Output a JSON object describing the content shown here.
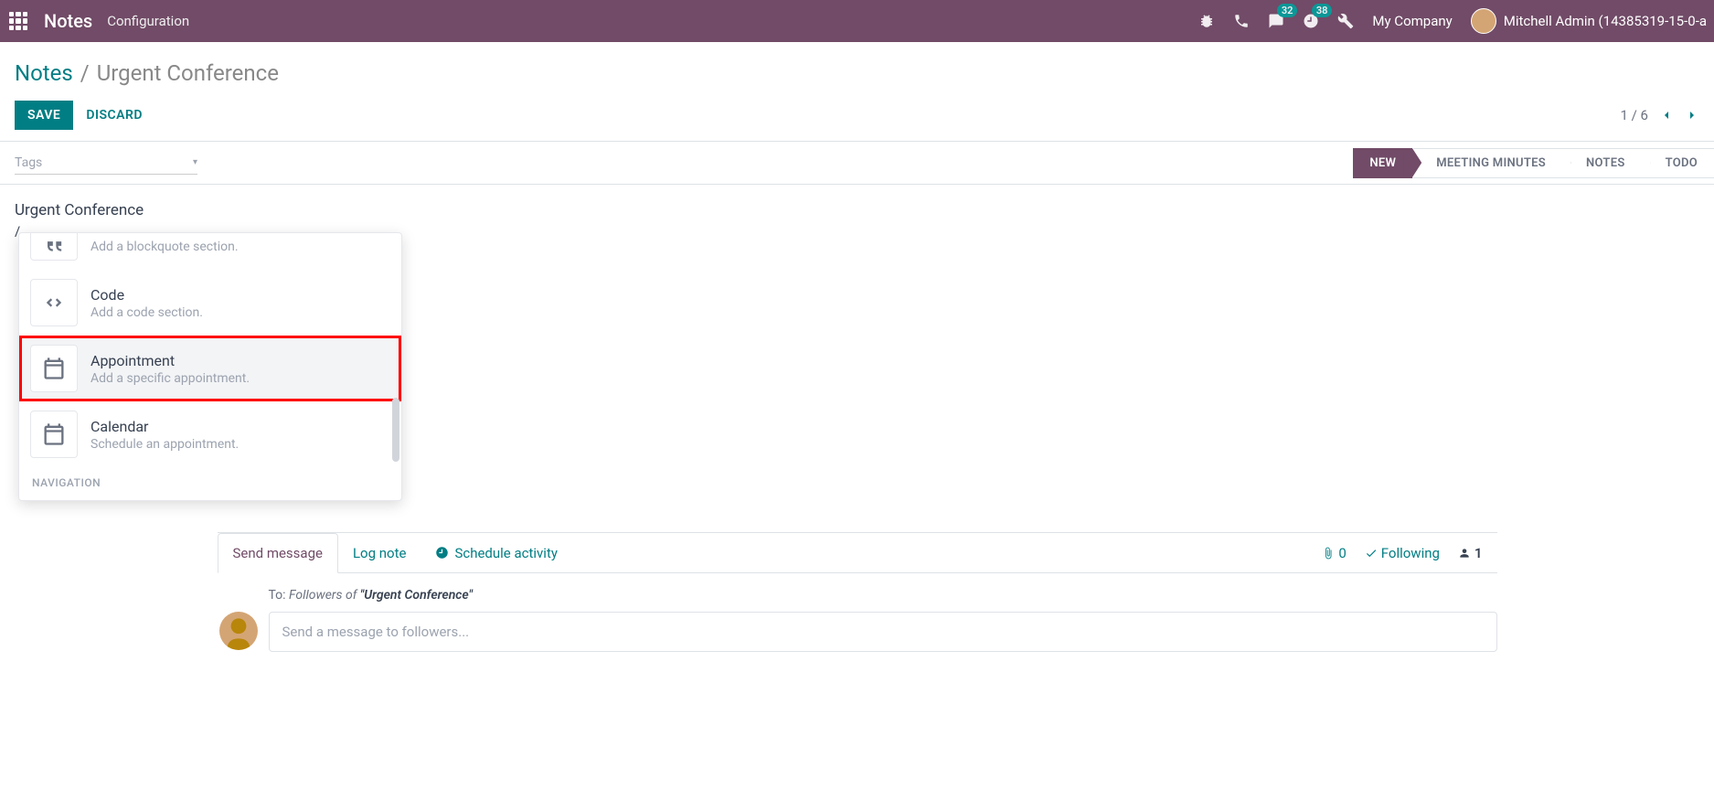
{
  "navbar": {
    "brand": "Notes",
    "menu": [
      "Configuration"
    ],
    "badges": {
      "messages": "32",
      "activities": "38"
    },
    "company": "My Company",
    "user": "Mitchell Admin (14385319-15-0-a"
  },
  "breadcrumb": {
    "root": "Notes",
    "current": "Urgent Conference"
  },
  "actions": {
    "save": "SAVE",
    "discard": "DISCARD",
    "pager": "1 / 6"
  },
  "form": {
    "tags_placeholder": "Tags",
    "title": "Urgent Conference",
    "slash": "/"
  },
  "statusbar": [
    {
      "label": "NEW",
      "active": true
    },
    {
      "label": "MEETING MINUTES",
      "active": false
    },
    {
      "label": "NOTES",
      "active": false
    },
    {
      "label": "TODO",
      "active": false
    }
  ],
  "commands": {
    "items": [
      {
        "title": "",
        "desc": "Add a blockquote section.",
        "icon": "quote",
        "partial": true
      },
      {
        "title": "Code",
        "desc": "Add a code section.",
        "icon": "code"
      },
      {
        "title": "Appointment",
        "desc": "Add a specific appointment.",
        "icon": "calendar",
        "highlight": true
      },
      {
        "title": "Calendar",
        "desc": "Schedule an appointment.",
        "icon": "calendar"
      }
    ],
    "section": "NAVIGATION"
  },
  "chatter": {
    "tabs": {
      "send": "Send message",
      "log": "Log note",
      "schedule": "Schedule activity"
    },
    "attachments": "0",
    "following": "Following",
    "followers": "1",
    "to_label": "To:",
    "to_prefix": "Followers of ",
    "to_doc": "\"Urgent Conference\"",
    "placeholder": "Send a message to followers..."
  }
}
